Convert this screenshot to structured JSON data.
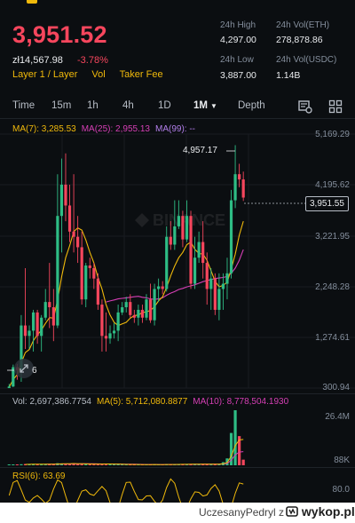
{
  "header": {
    "price": "3,951.52",
    "fiat_price": "zł14,567.98",
    "change": "-3.78%",
    "tags": [
      "Layer 1 / Layer",
      "Vol",
      "Taker Fee"
    ],
    "stats": {
      "high_label": "24h High",
      "high_value": "4,297.00",
      "vol_eth_label": "24h Vol(ETH)",
      "vol_eth_value": "278,878.86",
      "low_label": "24h Low",
      "low_value": "3,887.00",
      "vol_usdc_label": "24h Vol(USDC)",
      "vol_usdc_value": "1.14B"
    }
  },
  "tabs": [
    {
      "label": "Time"
    },
    {
      "label": "15m"
    },
    {
      "label": "1h"
    },
    {
      "label": "4h"
    },
    {
      "label": "1D"
    },
    {
      "label": "1M",
      "active": true
    },
    {
      "label": "Depth"
    }
  ],
  "ma_legend": {
    "ma7": "MA(7): 3,285.53",
    "ma25": "MA(25): 2,955.13",
    "ma99": "MA(99): --"
  },
  "price_axis": [
    "5,169.29",
    "4,195.62",
    "3,221.95",
    "2,248.28",
    "1,274.61",
    "300.94"
  ],
  "current_price_tag": "3,951.55",
  "high_marker": "4,957.17",
  "low_marker": "6",
  "volume_legend": {
    "vol": "Vol: 2,697,386.7754",
    "ma5": "MA(5): 5,712,080.8877",
    "ma10": "MA(10): 8,778,504.1930"
  },
  "volume_axis": [
    "26.4M",
    "88K"
  ],
  "rsi_legend": "RSI(6): 63.69",
  "rsi_axis": "80.0",
  "watermark": {
    "user": "UczesanyPedryl",
    "separator": "z",
    "site": "wykop.pl"
  },
  "colors": {
    "up": "#2ebd85",
    "down": "#f6465d",
    "ma7": "#f0b90b",
    "ma25": "#d63fb5",
    "ma99": "#b37feb",
    "accent": "#f0b90b"
  },
  "chart_data": {
    "type": "candlestick",
    "interval": "1M",
    "ylim": [
      300.94,
      5169.29
    ],
    "candles": [
      [
        300,
        380,
        310,
        330
      ],
      [
        330,
        750,
        320,
        700
      ],
      [
        700,
        760,
        460,
        640
      ],
      [
        640,
        1700,
        420,
        1500
      ],
      [
        1500,
        2600,
        1050,
        1300
      ],
      [
        1300,
        1500,
        1050,
        1400
      ],
      [
        1400,
        1800,
        1000,
        1750
      ],
      [
        1750,
        1800,
        1150,
        1300
      ],
      [
        1300,
        1700,
        1000,
        1650
      ],
      [
        1650,
        2200,
        1600,
        1950
      ],
      [
        1950,
        2700,
        1450,
        1850
      ],
      [
        1850,
        2200,
        1200,
        1500
      ],
      [
        1500,
        4400,
        1450,
        3600
      ],
      [
        3600,
        4700,
        2900,
        4200
      ],
      [
        4200,
        4800,
        3500,
        3800
      ],
      [
        3800,
        4200,
        3100,
        3300
      ],
      [
        3300,
        4400,
        2900,
        3200
      ],
      [
        3200,
        3600,
        2700,
        3000
      ],
      [
        3000,
        3300,
        1900,
        2000
      ],
      [
        2000,
        2700,
        1850,
        2650
      ],
      [
        2650,
        2800,
        2400,
        2600
      ],
      [
        2600,
        2700,
        2200,
        2400
      ],
      [
        2400,
        2500,
        1800,
        1900
      ],
      [
        1900,
        2000,
        1000,
        1300
      ],
      [
        1300,
        1750,
        1000,
        1250
      ],
      [
        1250,
        1500,
        1150,
        1350
      ],
      [
        1350,
        1550,
        1250,
        1400
      ],
      [
        1400,
        1900,
        1200,
        1750
      ],
      [
        1750,
        1950,
        1700,
        1850
      ],
      [
        1850,
        2050,
        1750,
        1950
      ],
      [
        1950,
        2100,
        1650,
        1700
      ],
      [
        1700,
        1800,
        1550,
        1650
      ],
      [
        1650,
        1900,
        1500,
        1800
      ],
      [
        1800,
        1900,
        1550,
        1650
      ],
      [
        1650,
        2100,
        1600,
        2000
      ],
      [
        2000,
        2300,
        1550,
        1600
      ],
      [
        1600,
        2300,
        1500,
        2200
      ],
      [
        2200,
        2400,
        1950,
        2250
      ],
      [
        2250,
        2350,
        2100,
        2200
      ],
      [
        2200,
        3400,
        2150,
        3200
      ],
      [
        3200,
        3500,
        2950,
        3050
      ],
      [
        3050,
        3900,
        2950,
        3400
      ],
      [
        3400,
        3900,
        3350,
        3600
      ],
      [
        3600,
        3700,
        3000,
        3150
      ],
      [
        3150,
        3900,
        3100,
        3600
      ],
      [
        3600,
        3700,
        2200,
        2300
      ],
      [
        2300,
        3200,
        2200,
        2800
      ],
      [
        2800,
        3300,
        2700,
        3100
      ],
      [
        3100,
        3500,
        2400,
        2700
      ],
      [
        2700,
        2900,
        1900,
        2200
      ],
      [
        2200,
        2600,
        1800,
        2400
      ],
      [
        2400,
        2500,
        1700,
        1800
      ],
      [
        1800,
        2500,
        1600,
        2200
      ],
      [
        2200,
        2500,
        1800,
        2300
      ],
      [
        2300,
        2800,
        2000,
        2500
      ],
      [
        2500,
        4100,
        2400,
        3900
      ],
      [
        3900,
        4957,
        3750,
        4400
      ],
      [
        4400,
        4600,
        4150,
        4300
      ],
      [
        4300,
        4450,
        3887,
        3952
      ]
    ],
    "ma7": [
      320,
      460,
      560,
      780,
      980,
      1040,
      1210,
      1320,
      1410,
      1540,
      1650,
      1640,
      1990,
      2430,
      2800,
      3030,
      3300,
      3370,
      3330,
      3140,
      2900,
      2700,
      2420,
      2200,
      1900,
      1700,
      1560,
      1500,
      1530,
      1560,
      1640,
      1690,
      1700,
      1750,
      1760,
      1790,
      1860,
      1970,
      2050,
      2230,
      2450,
      2640,
      2800,
      2900,
      3050,
      3100,
      2960,
      2880,
      2870,
      2750,
      2550,
      2350,
      2240,
      2270,
      2330,
      2580,
      2870,
      3230,
      3500
    ],
    "ma25": [
      null,
      null,
      null,
      null,
      null,
      null,
      null,
      null,
      null,
      null,
      null,
      null,
      null,
      null,
      null,
      null,
      null,
      null,
      null,
      null,
      null,
      null,
      null,
      null,
      1950,
      1970,
      1990,
      2010,
      2020,
      2030,
      2040,
      2050,
      2060,
      2040,
      2030,
      2010,
      2000,
      2010,
      2030,
      2080,
      2120,
      2150,
      2190,
      2210,
      2240,
      2260,
      2280,
      2310,
      2340,
      2360,
      2380,
      2400,
      2410,
      2420,
      2440,
      2500,
      2600,
      2750,
      2955
    ]
  },
  "volume_data": {
    "values": [
      0.3,
      0.4,
      0.4,
      0.5,
      0.6,
      0.5,
      0.6,
      0.5,
      0.4,
      0.5,
      0.6,
      0.5,
      1.0,
      0.9,
      0.8,
      0.7,
      0.8,
      0.6,
      0.7,
      0.6,
      0.5,
      0.5,
      0.6,
      0.8,
      0.7,
      0.5,
      0.4,
      0.5,
      0.4,
      0.4,
      0.4,
      0.3,
      0.4,
      0.3,
      0.4,
      0.4,
      0.4,
      0.3,
      0.3,
      0.5,
      0.4,
      0.5,
      0.5,
      0.4,
      0.5,
      0.6,
      0.5,
      0.5,
      0.5,
      0.6,
      0.5,
      0.6,
      0.5,
      1.5,
      3.3,
      15.5,
      26.4,
      14.0,
      2.7
    ],
    "ylim": [
      0.088,
      26.4
    ]
  }
}
